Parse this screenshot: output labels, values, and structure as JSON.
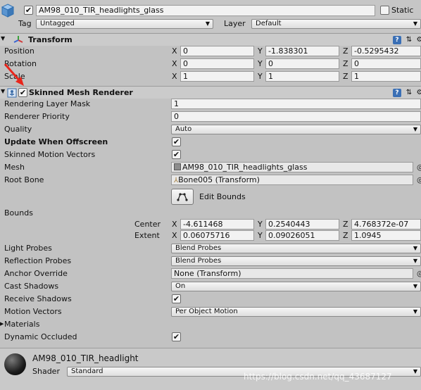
{
  "header": {
    "object_name": "AM98_010_TIR_headlights_glass",
    "static_label": "Static",
    "tag_label": "Tag",
    "tag_value": "Untagged",
    "layer_label": "Layer",
    "layer_value": "Default"
  },
  "transform": {
    "title": "Transform",
    "rows": [
      {
        "label": "Position",
        "x": "0",
        "y": "-1.838301",
        "z": "-0.5295432"
      },
      {
        "label": "Rotation",
        "x": "0",
        "y": "0",
        "z": "0"
      },
      {
        "label": "Scale",
        "x": "1",
        "y": "1",
        "z": "1"
      }
    ]
  },
  "axes": {
    "x": "X",
    "y": "Y",
    "z": "Z"
  },
  "renderer": {
    "title": "Skinned Mesh Renderer",
    "rendering_layer_mask_label": "Rendering Layer Mask",
    "rendering_layer_mask_value": "1",
    "renderer_priority_label": "Renderer Priority",
    "renderer_priority_value": "0",
    "quality_label": "Quality",
    "quality_value": "Auto",
    "update_offscreen_label": "Update When Offscreen",
    "skinned_motion_label": "Skinned Motion Vectors",
    "mesh_label": "Mesh",
    "mesh_value": "AM98_010_TIR_headlights_glass",
    "root_bone_label": "Root Bone",
    "root_bone_value": "Bone005 (Transform)",
    "edit_bounds_label": "Edit Bounds",
    "bounds_label": "Bounds",
    "center_label": "Center",
    "center": {
      "x": "-4.611468",
      "y": "0.2540443",
      "z": "4.768372e-07"
    },
    "extent_label": "Extent",
    "extent": {
      "x": "0.06075716",
      "y": "0.09026051",
      "z": "1.0945"
    },
    "light_probes_label": "Light Probes",
    "light_probes_value": "Blend Probes",
    "reflection_probes_label": "Reflection Probes",
    "reflection_probes_value": "Blend Probes",
    "anchor_override_label": "Anchor Override",
    "anchor_override_value": "None (Transform)",
    "cast_shadows_label": "Cast Shadows",
    "cast_shadows_value": "On",
    "receive_shadows_label": "Receive Shadows",
    "motion_vectors_label": "Motion Vectors",
    "motion_vectors_value": "Per Object Motion",
    "materials_label": "Materials",
    "dynamic_occluded_label": "Dynamic Occluded"
  },
  "material": {
    "name": "AM98_010_TIR_headlight",
    "shader_label": "Shader",
    "shader_value": "Standard"
  },
  "watermark": "https://blog.csdn.net/qq_43687127",
  "icons": [
    "cube-icon",
    "transform-icon",
    "skinned-mesh-icon",
    "help-icon",
    "preset-icon",
    "gear-icon",
    "mesh-icon",
    "bone-icon",
    "edit-bounds-icon",
    "material-sphere-icon",
    "red-arrow"
  ]
}
